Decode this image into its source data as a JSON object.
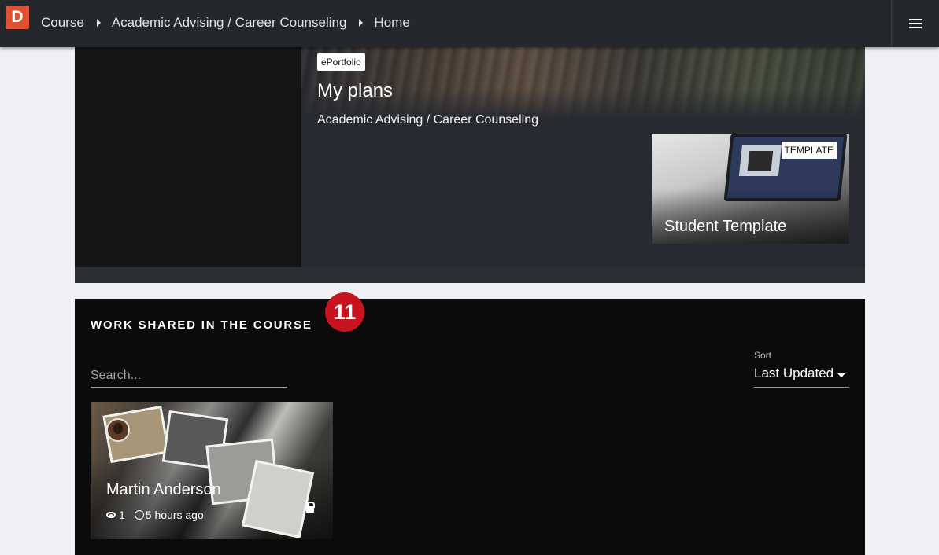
{
  "topbar": {
    "logo_letter": "D",
    "breadcrumbs": [
      "Course",
      "Academic Advising / Career Counseling",
      "Home"
    ]
  },
  "hero": {
    "badge": "ePortfolio",
    "title": "My plans",
    "subtitle": "Academic Advising / Career Counseling",
    "template_card": {
      "badge": "TEMPLATE",
      "title": "Student Template"
    }
  },
  "work_shared": {
    "title": "WORK SHARED IN THE COURSE",
    "count": "11",
    "search_placeholder": "Search...",
    "sort_label": "Sort",
    "sort_value": "Last Updated",
    "cards": [
      {
        "author": "Martin Anderson",
        "views": "1",
        "updated": "5 hours ago",
        "locked": true
      }
    ]
  },
  "colors": {
    "topbar": "#24272c",
    "logo": "#e0522f",
    "count_badge": "#c8141f",
    "section_bg": "#0b0b0b",
    "hero_bg": "#272a30"
  },
  "icons": [
    "menu-icon",
    "chevron-right-icon",
    "caret-down-icon",
    "eye-icon",
    "clock-icon",
    "lock-icon"
  ]
}
